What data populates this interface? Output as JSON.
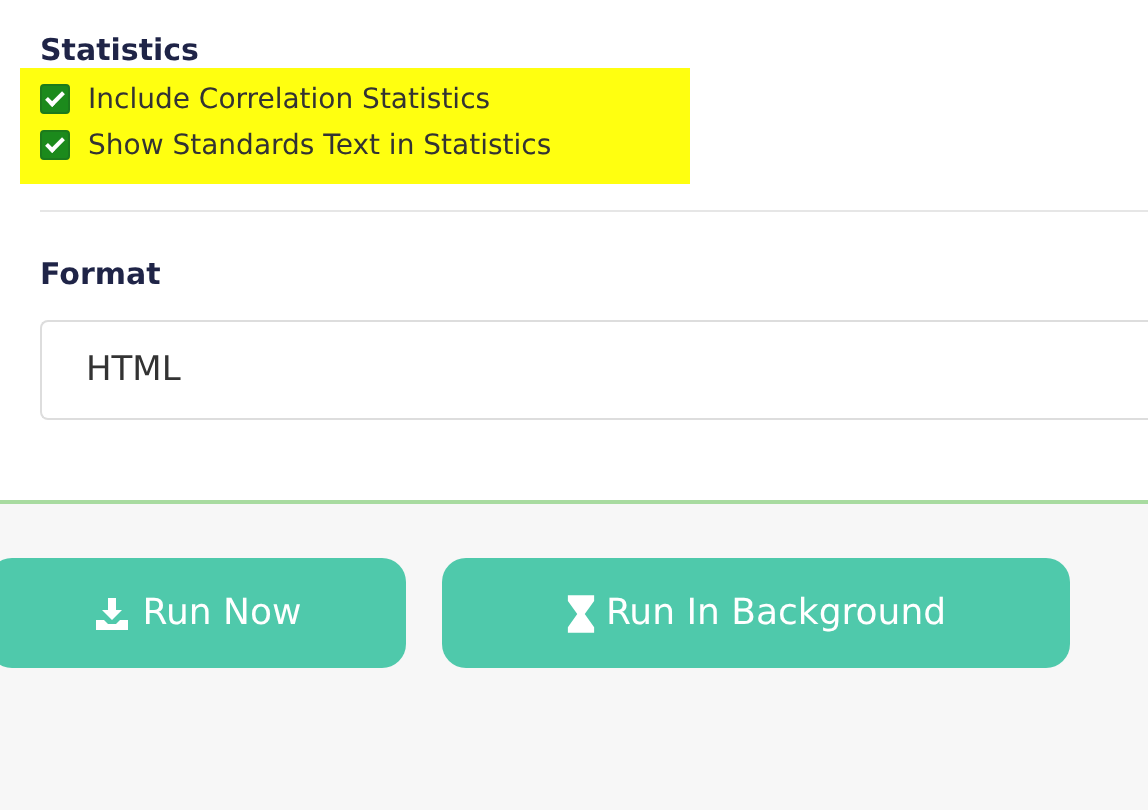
{
  "statistics": {
    "title": "Statistics",
    "highlighted": true,
    "options": [
      {
        "label": "Include Correlation Statistics",
        "checked": true
      },
      {
        "label": "Show Standards Text in Statistics",
        "checked": true
      }
    ]
  },
  "format": {
    "title": "Format",
    "value": "HTML"
  },
  "buttons": [
    {
      "label": "Run Now",
      "kind": "download"
    },
    {
      "label": "Run In Background",
      "kind": "hourglass"
    }
  ]
}
